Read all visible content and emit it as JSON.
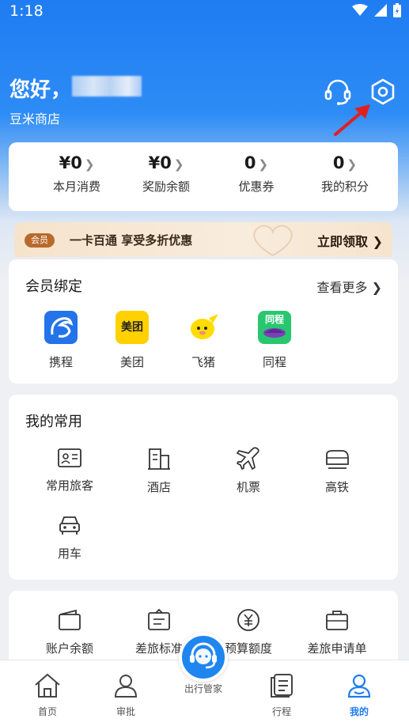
{
  "status_bar": {
    "time": "1:18"
  },
  "header": {
    "greeting": "您好，",
    "shop_name": "豆米商店"
  },
  "stats": [
    {
      "value": "¥0",
      "label": "本月消费"
    },
    {
      "value": "¥0",
      "label": "奖励余额"
    },
    {
      "value": "0",
      "label": "优惠券"
    },
    {
      "value": "0",
      "label": "我的积分"
    }
  ],
  "promo": {
    "badge": "会员",
    "text": "一卡百通 享受多折优惠",
    "cta": "立即领取 ❯"
  },
  "member_binding": {
    "title": "会员绑定",
    "more": "查看更多 ❯",
    "brands": [
      {
        "name": "携程",
        "color": "#2473e8"
      },
      {
        "name": "美团",
        "logo_text": "美团",
        "color": "#ffd100"
      },
      {
        "name": "飞猪",
        "color": "#ffdd00"
      },
      {
        "name": "同程",
        "logo_text": "同程",
        "color": "#28c76f"
      }
    ]
  },
  "frequent": {
    "title": "我的常用",
    "items": [
      {
        "name": "常用旅客",
        "icon": "traveler-card-icon"
      },
      {
        "name": "酒店",
        "icon": "hotel-icon"
      },
      {
        "name": "机票",
        "icon": "airplane-icon"
      },
      {
        "name": "高铁",
        "icon": "train-icon"
      },
      {
        "name": "用车",
        "icon": "car-icon"
      }
    ]
  },
  "finance": {
    "items": [
      {
        "name": "账户余额",
        "icon": "wallet-icon"
      },
      {
        "name": "差旅标准",
        "icon": "policy-icon"
      },
      {
        "name": "预算额度",
        "icon": "yen-icon"
      },
      {
        "name": "差旅申请单",
        "icon": "briefcase-icon"
      }
    ]
  },
  "tabbar": {
    "tabs": [
      {
        "name": "首页",
        "icon": "home-icon"
      },
      {
        "name": "审批",
        "icon": "person-icon"
      },
      {
        "name": "出行管家",
        "icon": "headset-icon"
      },
      {
        "name": "行程",
        "icon": "itinerary-icon"
      },
      {
        "name": "我的",
        "icon": "profile-icon",
        "active": true
      }
    ]
  },
  "colors": {
    "primary": "#1f7cf2",
    "annotation_arrow": "#e02020"
  }
}
